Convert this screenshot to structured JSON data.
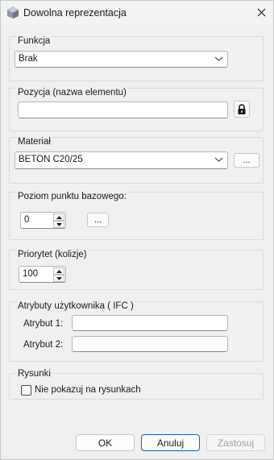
{
  "window": {
    "title": "Dowolna reprezentacja"
  },
  "funkcja": {
    "label": "Funkcja",
    "value": "Brak"
  },
  "pozycja": {
    "label": "Pozycja (nazwa elementu)",
    "value": ""
  },
  "material": {
    "label": "Materiał",
    "value": "BETON C20/25",
    "browse_label": "..."
  },
  "poziom": {
    "label": "Poziom punktu bazowego:",
    "value": "0",
    "browse_label": "..."
  },
  "priorytet": {
    "label": "Priorytet (kolizje)",
    "value": "100"
  },
  "atrybuty": {
    "label": "Atrybuty użytkownika ( IFC )",
    "attr1_label": "Atrybut 1:",
    "attr1_value": "",
    "attr2_label": "Atrybut 2:",
    "attr2_value": ""
  },
  "rysunki": {
    "label": "Rysunki",
    "checkbox_label": "Nie pokazuj na rysunkach",
    "checked": false
  },
  "footer": {
    "ok": "OK",
    "cancel": "Anuluj",
    "apply": "Zastosuj"
  },
  "colors": {
    "accent": "#1a5fb4",
    "background": "#f0f0f0"
  },
  "icons": {
    "lock": "lock-icon",
    "app": "app-icon",
    "close": "close-icon"
  }
}
